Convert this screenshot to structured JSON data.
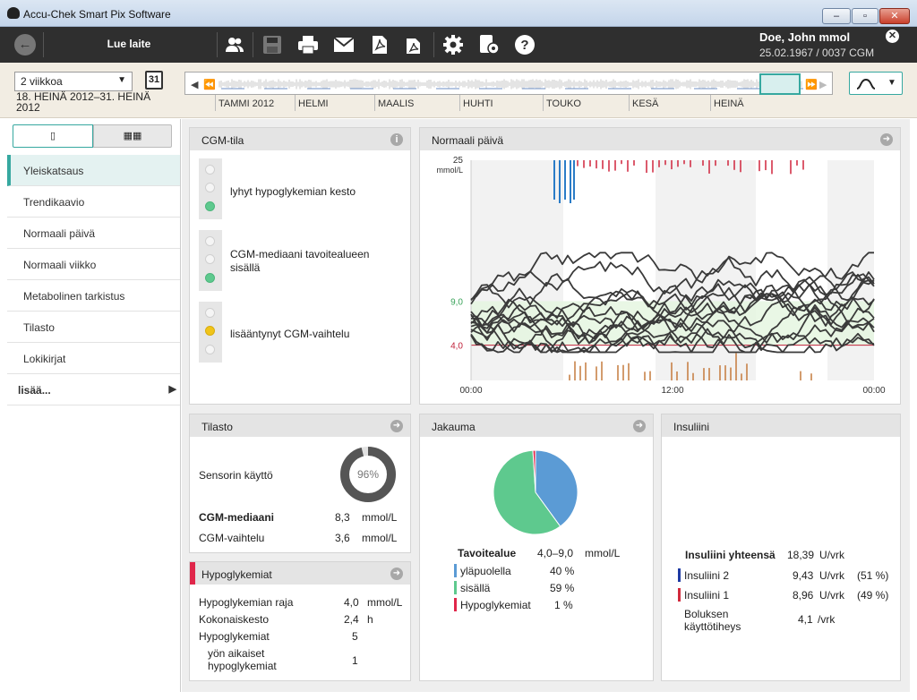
{
  "window": {
    "title": "Accu-Chek Smart Pix Software",
    "min": "–",
    "max": "▫",
    "close": "✕"
  },
  "toolbar": {
    "read_device": "Lue laite",
    "user_name": "Doe, John mmol",
    "user_info": "25.02.1967 / 0037 CGM"
  },
  "datebar": {
    "period_value": "2 viikkoa",
    "calendar_day": "31",
    "date_range": "18. HEINÄ 2012–31. HEINÄ 2012",
    "months": [
      "TAMMI 2012",
      "HELMI",
      "MAALIS",
      "HUHTI",
      "TOUKO",
      "KESÄ",
      "HEINÄ"
    ]
  },
  "sidebar": {
    "items": [
      {
        "label": "Yleiskatsaus"
      },
      {
        "label": "Trendikaavio"
      },
      {
        "label": "Normaali päivä"
      },
      {
        "label": "Normaali viikko"
      },
      {
        "label": "Metabolinen tarkistus"
      },
      {
        "label": "Tilasto"
      },
      {
        "label": "Lokikirjat"
      }
    ],
    "more": "lisää..."
  },
  "cgm": {
    "title": "CGM-tila",
    "rows": [
      {
        "label": "lyhyt hypoglykemian kesto"
      },
      {
        "label": "CGM-mediaani tavoitealueen sisällä"
      },
      {
        "label": "lisääntynyt CGM-vaihtelu"
      }
    ]
  },
  "normal_day": {
    "title": "Normaali päivä",
    "y_top": "25",
    "y_unit": "mmol/L",
    "y_high": "9,0",
    "y_low": "4,0",
    "x_labels": [
      "00:00",
      "12:00",
      "00:00"
    ]
  },
  "stats": {
    "title": "Tilasto",
    "sensor_label": "Sensorin käyttö",
    "sensor_value": "96%",
    "sensor_fraction": 0.96,
    "median_label": "CGM-mediaani",
    "median_value": "8,3",
    "median_unit": "mmol/L",
    "var_label": "CGM-vaihtelu",
    "var_value": "3,6",
    "var_unit": "mmol/L"
  },
  "hypo": {
    "title": "Hypoglykemiat",
    "rows": [
      {
        "label": "Hypoglykemian raja",
        "value": "4,0",
        "unit": "mmol/L"
      },
      {
        "label": "Kokonaiskesto",
        "value": "2,4",
        "unit": "h"
      },
      {
        "label": "Hypoglykemiat",
        "value": "5",
        "unit": ""
      },
      {
        "label": "yön aikaiset hypoglykemiat",
        "value": "1",
        "unit": ""
      }
    ]
  },
  "dist": {
    "title": "Jakauma",
    "target_label": "Tavoitealue",
    "target_range": "4,0–9,0",
    "target_unit": "mmol/L",
    "rows": [
      {
        "label": "yläpuolella",
        "value": "40 %",
        "color": "#5b9bd5"
      },
      {
        "label": "sisällä",
        "value": "59 %",
        "color": "#5ec98e"
      },
      {
        "label": "Hypoglykemiat",
        "value": "1 %",
        "color": "#e0264a"
      }
    ],
    "fractions": [
      0.4,
      0.59,
      0.01
    ]
  },
  "insulin": {
    "title": "Insuliini",
    "total_label": "Insuliini yhteensä",
    "total_value": "18,39",
    "total_unit": "U/vrk",
    "rows": [
      {
        "label": "Insuliini 2",
        "value": "9,43",
        "unit": "U/vrk",
        "pct": "(51 %)",
        "color": "#1f3aa3"
      },
      {
        "label": "Insuliini 1",
        "value": "8,96",
        "unit": "U/vrk",
        "pct": "(49 %)",
        "color": "#d12a3c"
      }
    ],
    "bolus_label": "Boluksen käyttötiheys",
    "bolus_value": "4,1",
    "bolus_unit": "/vrk"
  }
}
